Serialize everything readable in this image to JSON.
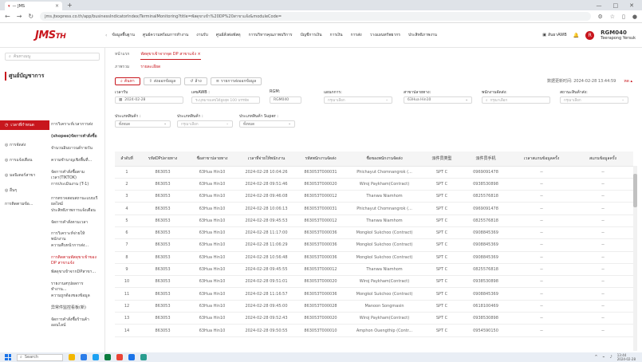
{
  "browser": {
    "tab_title": "— JMS",
    "new_tab": "+",
    "window_controls": [
      "—",
      "□",
      "✕"
    ],
    "url": "jms.jtexpress.co.th/app/businessIndicatorIndex/TerminalMonitoring?title=พัสดุขาเข้า%20DP%20สาขาแจ้ง&moduleCode="
  },
  "app": {
    "logo": "JMS",
    "logo_suffix": "TH",
    "top_menu": [
      "ข้อมูลพื้นฐาน",
      "ศูนย์ความพร้อมการทำงาน",
      "งานรับ",
      "ศูนย์สั่งต่อพัสดุ",
      "การบริหารคุณภาพบริการ",
      "บัญชีการเงิน",
      "การเงิน",
      "การส่ง",
      "วางแผนทรัพยากร",
      "ประสิทธิภาพงาน"
    ],
    "ai_button": "สันยาAWB",
    "user_name": "RGM040",
    "user_sub": "Teerapong Yersuk",
    "avatar": "R"
  },
  "sidebar": {
    "search_placeholder": "ค้นหาเมนู",
    "title": "ศูนย์บัญชาการ",
    "left_items": [
      "เวลาที่กำหนด",
      "การจัดส่ง",
      "การแจ้งเตือน",
      "มอนิเตอร์สาขา",
      "อื่นๆ",
      "การติดตามข้อ..."
    ],
    "right_items": [
      "การวิเคราะห์เวลาการส่ง",
      "(shopee)จัดการคำสั่งซื้อ",
      "จำนวนอินบาวนด์รายวัน",
      "ความชำนาญเชิงพื้นที่...",
      "จัดการคำสั่งซื้อตามเวลา(TIKTOK)",
      "การประเมินงาน (T-1)",
      "การตรวจสอบสถานะแบบเรียลไทม์",
      "ประสิทธิภาพการแจ้งเตือน",
      "จัดการคำสั่งตามเวลา",
      "การวิเคราะห์จ่ายให้พนักงาน",
      "ความคืบหน้าการส่ง...",
      "การติดตามพัสดุขาเข้าของ DP สาขาแจ้ง",
      "พัสดุขาเข้าจากDPสาขา...",
      "รายงานสรุปผลการทำงาน...",
      "ความถูกต้องของข้อมูล",
      "异常件监控看板(新)",
      "จัดการคำสั่งซื้อร้านค้าออนไลน์"
    ]
  },
  "main": {
    "page_tabs": [
      "หน้าแรก",
      "พัสดุขาเข้าจากจุด DP สาขาแจ้ง ×"
    ],
    "sub_tabs": [
      "ภาพรวม",
      "รายละเอียด"
    ],
    "buttons": {
      "search": "ค้นหา",
      "export": "ส่งออกข้อมูล",
      "reset": "ล้าง",
      "export_list": "รายการส่งออกข้อมูล"
    },
    "last_update": "数据更新时间: 2024-02-28 13:44:59",
    "collapse": "หด ▴",
    "filters": {
      "date_label": "เวลารับ",
      "date_value": "2024-02-28",
      "awb_label": "เลขAWB :",
      "awb_placeholder": "ระบุหมายเลขได้สูงสุด 100 บรรทัด",
      "rgm_label": "RGM:",
      "rgm_value": "RGM040",
      "region_label": "แผนกการ:",
      "region_placeholder": "กรุณาเลือก",
      "branch_label": "สาขาปลายทาง:",
      "branch_value": "63Hua Hin10",
      "staff_label": "พนักงานจัดส่ง:",
      "staff_placeholder": "กรุณาเลือก",
      "status_label": "สถานะสินค้าส่ง:",
      "status_placeholder": "กรุณาเลือก",
      "type_label": "ประเภทสินค้า :",
      "type_value": "ทั้งหมด",
      "cat_label": "ประเภทสินค้า :",
      "cat_placeholder": "กรุณาเลือก",
      "super_label": "ประเภทสินค้า Super :",
      "super_value": "ทั้งหมด"
    },
    "columns": [
      "ลำดับที่",
      "รหัสDPปลายทาง",
      "ชื่อสาขาปลายทาง",
      "เวลาที่จ่ายให้พนักงาน",
      "รหัสพนักงานจัดส่ง",
      "ชื่อของพนักงานจัดส่ง",
      "派件员类型",
      "派件员手机",
      "เวลาสแกนข้อมูลครั้ง",
      "สแกนข้อมูลครั้ง"
    ],
    "rows": [
      [
        "1",
        "863053",
        "63Hua Hin10",
        "2024-02-28 10:04:26",
        "863053T000031",
        "Phichayut Chomnangrok (...",
        "SPT C",
        "0969091478",
        "--",
        "--"
      ],
      [
        "2",
        "863053",
        "63Hua Hin10",
        "2024-02-28 09:51:46",
        "863053T000020",
        "Wiroj Paykham(Contract)",
        "SPT C",
        "0938530898",
        "--",
        "--"
      ],
      [
        "3",
        "863053",
        "63Hua Hin10",
        "2024-02-28 09:46:08",
        "863053T000012",
        "Thanwa Niamhom",
        "SPT C",
        "0825576818",
        "--",
        "--"
      ],
      [
        "4",
        "863053",
        "63Hua Hin10",
        "2024-02-28 10:06:13",
        "863053T000031",
        "Phichayut Chomnangrok (...",
        "SPT C",
        "0969091478",
        "--",
        "--"
      ],
      [
        "5",
        "863053",
        "63Hua Hin10",
        "2024-02-28 09:45:53",
        "863053T000012",
        "Thanwa Niamhom",
        "SPT C",
        "0825576818",
        "--",
        "--"
      ],
      [
        "6",
        "863053",
        "63Hua Hin10",
        "2024-02-28 11:17:00",
        "863053T000036",
        "Mongkol Sukchoo (Contract)",
        "SPT C",
        "0908845369",
        "--",
        "--"
      ],
      [
        "7",
        "863053",
        "63Hua Hin10",
        "2024-02-28 11:06:29",
        "863053T000036",
        "Mongkol Sukchoo (Contract)",
        "SPT C",
        "0908845369",
        "--",
        "--"
      ],
      [
        "8",
        "863053",
        "63Hua Hin10",
        "2024-02-28 10:56:48",
        "863053T000036",
        "Mongkol Sukchoo (Contract)",
        "SPT C",
        "0908845369",
        "--",
        "--"
      ],
      [
        "9",
        "863053",
        "63Hua Hin10",
        "2024-02-28 09:45:55",
        "863053T000012",
        "Thanwa Niamhom",
        "SPT C",
        "0825576818",
        "--",
        "--"
      ],
      [
        "10",
        "863053",
        "63Hua Hin10",
        "2024-02-28 09:51:01",
        "863053T000020",
        "Wiroj Paykham(Contract)",
        "SPT C",
        "0938530898",
        "--",
        "--"
      ],
      [
        "11",
        "863053",
        "63Hua Hin10",
        "2024-02-28 11:16:57",
        "863053T000036",
        "Mongkol Sukchoo (Contract)",
        "SPT C",
        "0908845369",
        "--",
        "--"
      ],
      [
        "12",
        "863053",
        "63Hua Hin10",
        "2024-02-28 09:45:00",
        "863053T000028",
        "Manoon Songmasin",
        "SPT C",
        "0618100469",
        "--",
        "--"
      ],
      [
        "13",
        "863053",
        "63Hua Hin10",
        "2024-02-28 09:52:43",
        "863053T000020",
        "Wiroj Paykham(Contract)",
        "SPT C",
        "0938530898",
        "--",
        "--"
      ],
      [
        "14",
        "863053",
        "63Hua Hin10",
        "2024-02-28 09:50:55",
        "863053T000010",
        "Amphon Ouengthip (Contr...",
        "SPT C",
        "0954590150",
        "--",
        "--"
      ]
    ]
  },
  "taskbar": {
    "search": "Search",
    "time": "13:44",
    "date": "2024-02-28"
  },
  "colors": {
    "brand": "#c8161d",
    "taskbar": "#e9eef5"
  }
}
